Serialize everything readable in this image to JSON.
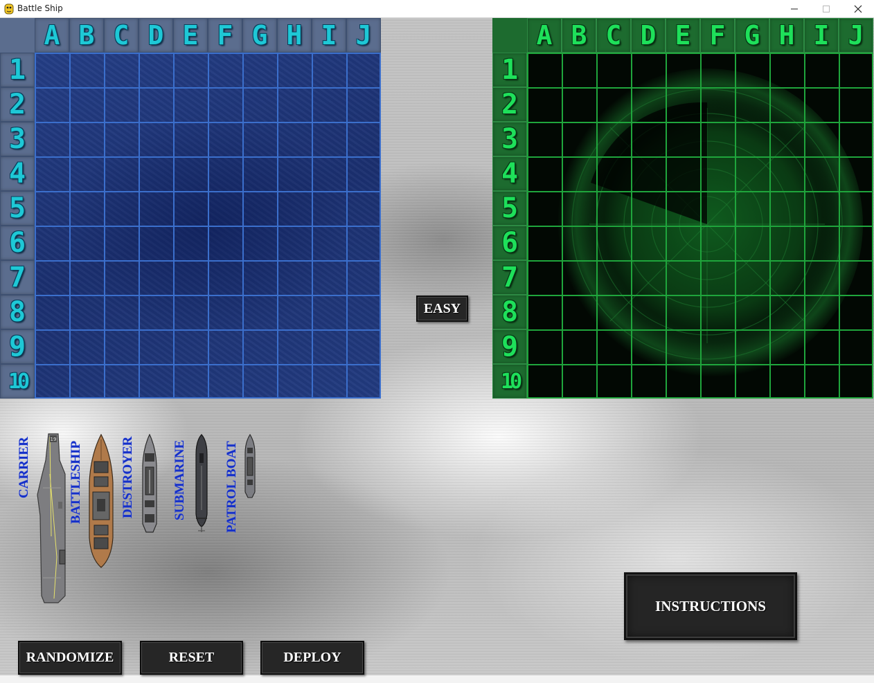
{
  "window": {
    "title": "Battle Ship"
  },
  "player_board": {
    "columns": [
      "A",
      "B",
      "C",
      "D",
      "E",
      "F",
      "G",
      "H",
      "I",
      "J"
    ],
    "rows": [
      "1",
      "2",
      "3",
      "4",
      "5",
      "6",
      "7",
      "8",
      "9",
      "10"
    ],
    "theme": "ocean",
    "header_color": "#1ec8d6",
    "grid_color": "#3b6fcc"
  },
  "enemy_board": {
    "columns": [
      "A",
      "B",
      "C",
      "D",
      "E",
      "F",
      "G",
      "H",
      "I",
      "J"
    ],
    "rows": [
      "1",
      "2",
      "3",
      "4",
      "5",
      "6",
      "7",
      "8",
      "9",
      "10"
    ],
    "theme": "radar",
    "header_color": "#1ee05a",
    "grid_color": "#1fa53c"
  },
  "difficulty": {
    "label": "EASY"
  },
  "fleet": {
    "ships": [
      {
        "name": "CARRIER",
        "icon": "carrier-icon"
      },
      {
        "name": "BATTLESHIP",
        "icon": "battleship-icon"
      },
      {
        "name": "DESTROYER",
        "icon": "destroyer-icon"
      },
      {
        "name": "SUBMARINE",
        "icon": "submarine-icon"
      },
      {
        "name": "PATROL BOAT",
        "icon": "patrol-boat-icon"
      }
    ],
    "label_color": "#1530c8"
  },
  "controls": {
    "randomize_label": "RANDOMIZE",
    "reset_label": "RESET",
    "deploy_label": "DEPLOY",
    "instructions_label": "INSTRUCTIONS"
  }
}
